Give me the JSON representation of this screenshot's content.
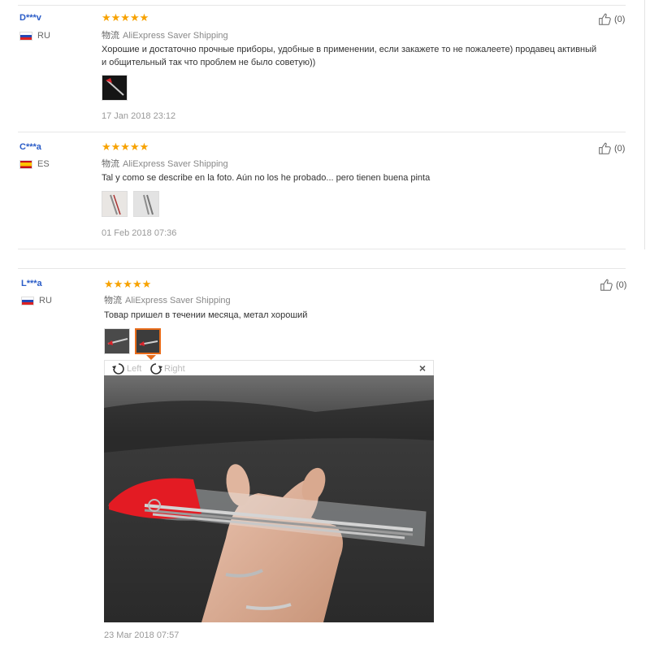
{
  "reviews": [
    {
      "user": "D***v",
      "country": "RU",
      "stars": "★★★★★",
      "shipping_label": "物流",
      "shipping": "AliExpress Saver Shipping",
      "text_lines": [
        "Хорошие и достаточно прочные приборы, удобные в применении, если закажете то не пожалеете) продавец активный",
        "и общительный так что проблем не было советую))"
      ],
      "date": "17 Jan 2018 23:12",
      "helpful": "(0)"
    },
    {
      "user": "C***a",
      "country": "ES",
      "stars": "★★★★★",
      "shipping_label": "物流",
      "shipping": "AliExpress Saver Shipping",
      "text_lines": [
        "Tal y como se describe en la foto. Aún no los he probado... pero tienen buena pinta"
      ],
      "date": "01 Feb 2018 07:36",
      "helpful": "(0)"
    },
    {
      "user": "L***a",
      "country": "RU",
      "stars": "★★★★★",
      "shipping_label": "物流",
      "shipping": "AliExpress Saver Shipping",
      "text_lines": [
        "Товар пришел в течении месяца, метал хороший"
      ],
      "date": "23 Mar 2018 07:57",
      "helpful": "(0)"
    }
  ],
  "viewer": {
    "rotate_left": "Left",
    "rotate_right": "Right",
    "close": "×"
  },
  "colors": {
    "star": "#f7a200",
    "username": "#2a5cc7",
    "accent": "#e86c1a"
  }
}
